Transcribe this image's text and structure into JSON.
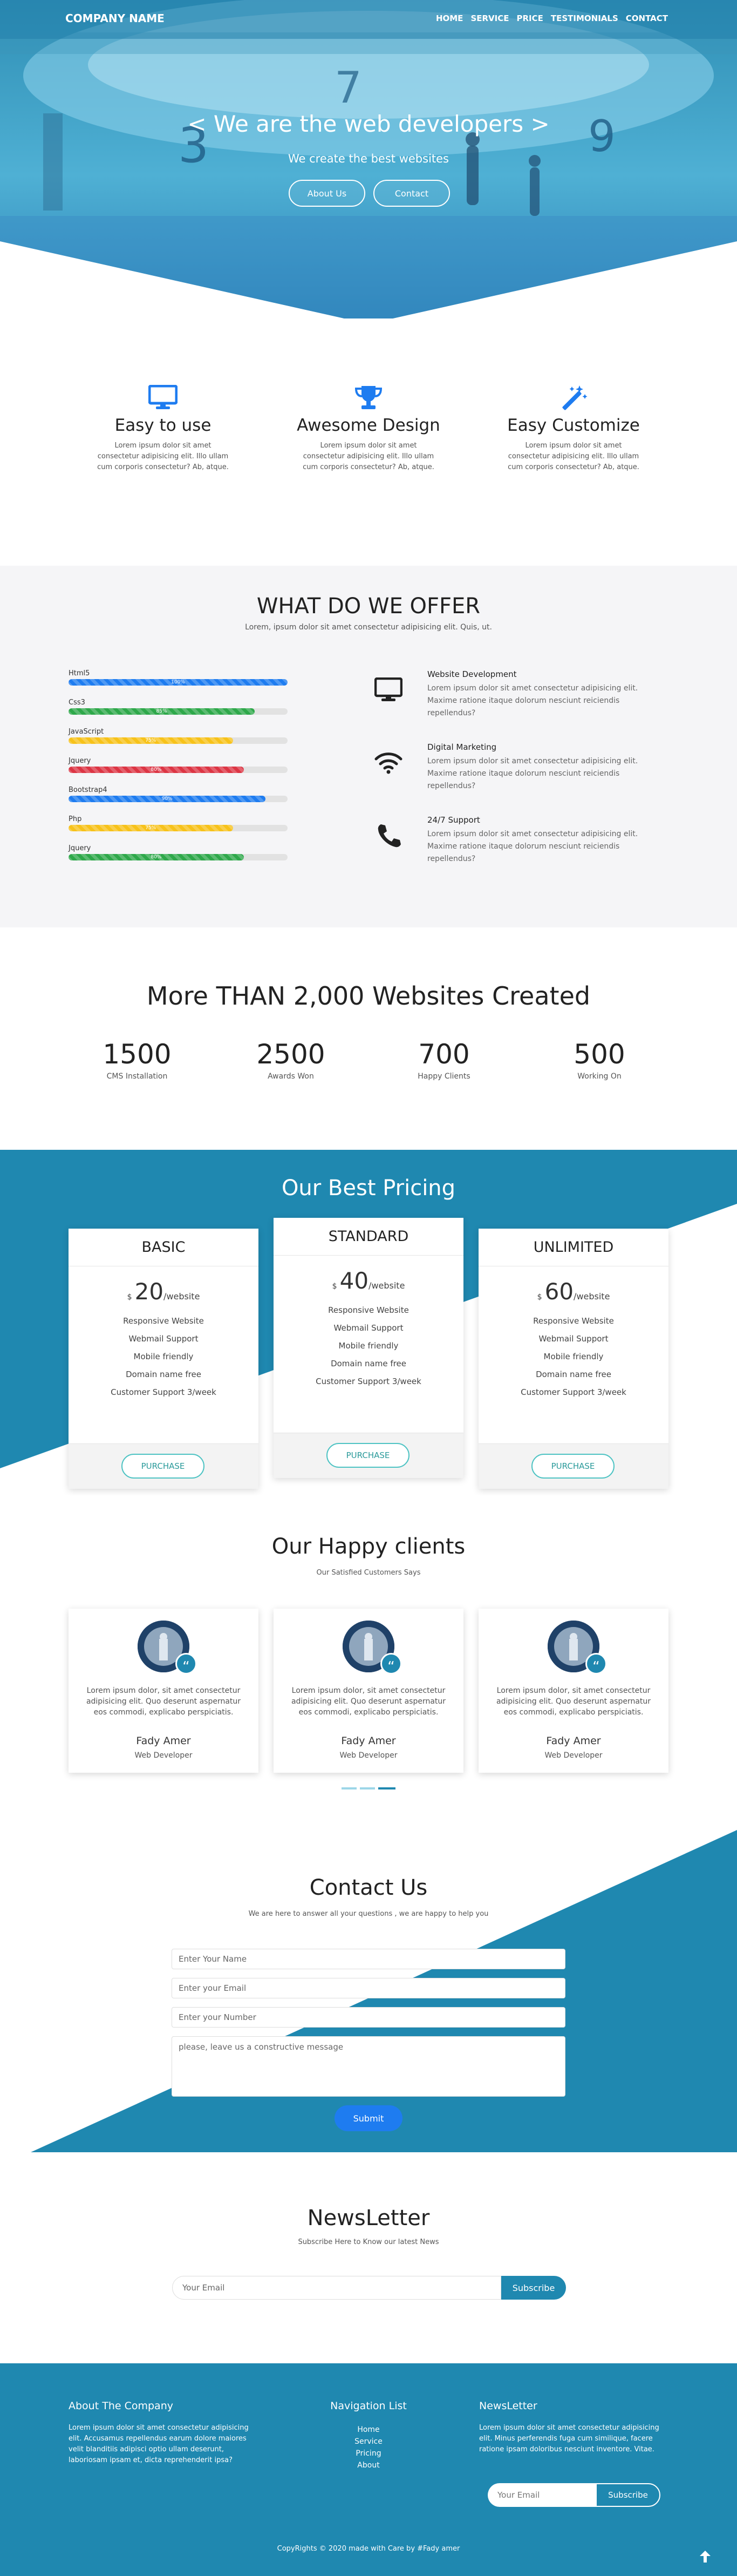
{
  "nav": {
    "brand": "COMPANY NAME",
    "links": [
      "HOME",
      "SERVICE",
      "PRICE",
      "TESTIMONIALS",
      "CONTACT"
    ]
  },
  "hero": {
    "title": "< We are the web developers >",
    "subtitle": "We create the best websites",
    "btn_about": "About Us",
    "btn_contact": "Contact"
  },
  "features": [
    {
      "icon": "monitor-icon",
      "title": "Easy to use",
      "text": "Lorem ipsum dolor sit amet consectetur adipisicing elit. Illo ullam cum corporis consectetur? Ab, atque."
    },
    {
      "icon": "trophy-icon",
      "title": "Awesome Design",
      "text": "Lorem ipsum dolor sit amet consectetur adipisicing elit. Illo ullam cum corporis consectetur? Ab, atque."
    },
    {
      "icon": "magic-wand-icon",
      "title": "Easy Customize",
      "text": "Lorem ipsum dolor sit amet consectetur adipisicing elit. Illo ullam cum corporis consectetur? Ab, atque."
    }
  ],
  "offer": {
    "title": "WHAT DO WE OFFER",
    "subtitle": "Lorem, ipsum dolor sit amet consectetur adipisicing elit. Quis, ut.",
    "skills": [
      {
        "name": "Html5",
        "percent": 100,
        "label": "100%",
        "color": "#1e7cf0"
      },
      {
        "name": "Css3",
        "percent": 85,
        "label": "85%",
        "color": "#2ea84a"
      },
      {
        "name": "JavaScript",
        "percent": 75,
        "label": "75%",
        "color": "#f7c21a"
      },
      {
        "name": "Jquery",
        "percent": 80,
        "label": "80%",
        "color": "#dc3544"
      },
      {
        "name": "Bootstrap4",
        "percent": 90,
        "label": "90%",
        "color": "#1e7cf0"
      },
      {
        "name": "Php",
        "percent": 75,
        "label": "75%",
        "color": "#f7c21a"
      },
      {
        "name": "Jquery",
        "percent": 80,
        "label": "80%",
        "color": "#2ea84a"
      }
    ],
    "services": [
      {
        "icon": "desktop-icon",
        "title": "Website Development",
        "text": "Lorem ipsum dolor sit amet consectetur adipisicing elit. Maxime ratione itaque dolorum nesciunt reiciendis repellendus?"
      },
      {
        "icon": "wifi-icon",
        "title": "Digital Marketing",
        "text": "Lorem ipsum dolor sit amet consectetur adipisicing elit. Maxime ratione itaque dolorum nesciunt reiciendis repellendus?"
      },
      {
        "icon": "phone-icon",
        "title": "24/7 Support",
        "text": "Lorem ipsum dolor sit amet consectetur adipisicing elit. Maxime ratione itaque dolorum nesciunt reiciendis repellendus?"
      }
    ]
  },
  "stats": {
    "title": "More THAN 2,000 Websites Created",
    "items": [
      {
        "value": "1500",
        "label": "CMS Installation"
      },
      {
        "value": "2500",
        "label": "Awards Won"
      },
      {
        "value": "700",
        "label": "Happy Clients"
      },
      {
        "value": "500",
        "label": "Working On"
      }
    ]
  },
  "pricing": {
    "title": "Our Best Pricing",
    "plans": [
      {
        "name": "BASIC",
        "currency": "$",
        "amount": "20",
        "period": "/website",
        "features": [
          "Responsive Website",
          "Webmail Support",
          "Mobile friendly",
          "Domain name free",
          "Customer Support 3/week"
        ],
        "button": "PURCHASE"
      },
      {
        "name": "STANDARD",
        "currency": "$",
        "amount": "40",
        "period": "/website",
        "features": [
          "Responsive Website",
          "Webmail Support",
          "Mobile friendly",
          "Domain name free",
          "Customer Support 3/week"
        ],
        "button": "PURCHASE"
      },
      {
        "name": "UNLIMITED",
        "currency": "$",
        "amount": "60",
        "period": "/website",
        "features": [
          "Responsive Website",
          "Webmail Support",
          "Mobile friendly",
          "Domain name free",
          "Customer Support 3/week"
        ],
        "button": "PURCHASE"
      }
    ]
  },
  "clients": {
    "title": "Our Happy clients",
    "subtitle": "Our Satisfied Customers Says",
    "items": [
      {
        "quote": "Lorem ipsum dolor, sit amet consectetur adipisicing elit. Quo deserunt aspernatur eos commodi, explicabo perspiciatis.",
        "name": "Fady Amer",
        "role": "Web Developer"
      },
      {
        "quote": "Lorem ipsum dolor, sit amet consectetur adipisicing elit. Quo deserunt aspernatur eos commodi, explicabo perspiciatis.",
        "name": "Fady Amer",
        "role": "Web Developer"
      },
      {
        "quote": "Lorem ipsum dolor, sit amet consectetur adipisicing elit. Quo deserunt aspernatur eos commodi, explicabo perspiciatis.",
        "name": "Fady Amer",
        "role": "Web Developer"
      }
    ]
  },
  "contact": {
    "title": "Contact Us",
    "subtitle": "We are here to answer all your questions , we are happy to help you",
    "name_placeholder": "Enter Your Name",
    "email_placeholder": "Enter your Email",
    "number_placeholder": "Enter your Number",
    "message_placeholder": "please, leave us a constructive message",
    "submit": "Submit"
  },
  "newsletter": {
    "title": "NewsLetter",
    "subtitle": "Subscribe Here to Know our latest News",
    "placeholder": "Your Email",
    "button": "Subscribe"
  },
  "footer": {
    "about_title": "About The Company",
    "about_text": "Lorem ipsum dolor sit amet consectetur adipisicing elit. Accusamus repellendus earum dolore maiores velit blanditiis adipisci optio ullam deserunt, laboriosam ipsam et, dicta reprehenderit ipsa?",
    "nav_title": "Navigation List",
    "nav_links": [
      "Home",
      "Service",
      "Pricing",
      "About"
    ],
    "news_title": "NewsLetter",
    "news_text": "Lorem ipsum dolor sit amet consectetur adipisicing elit. Minus perferendis fuga cum similique, facere ratione ipsam doloribus nesciunt inventore. Vitae.",
    "email_placeholder": "Your Email",
    "subscribe": "Subscribe",
    "copyright": "CopyRights © 2020 made with Care by #Fady amer"
  },
  "colors": {
    "primary": "#1f88b0",
    "blue": "#1e7cf0",
    "bg_gray": "#f5f5f7"
  }
}
